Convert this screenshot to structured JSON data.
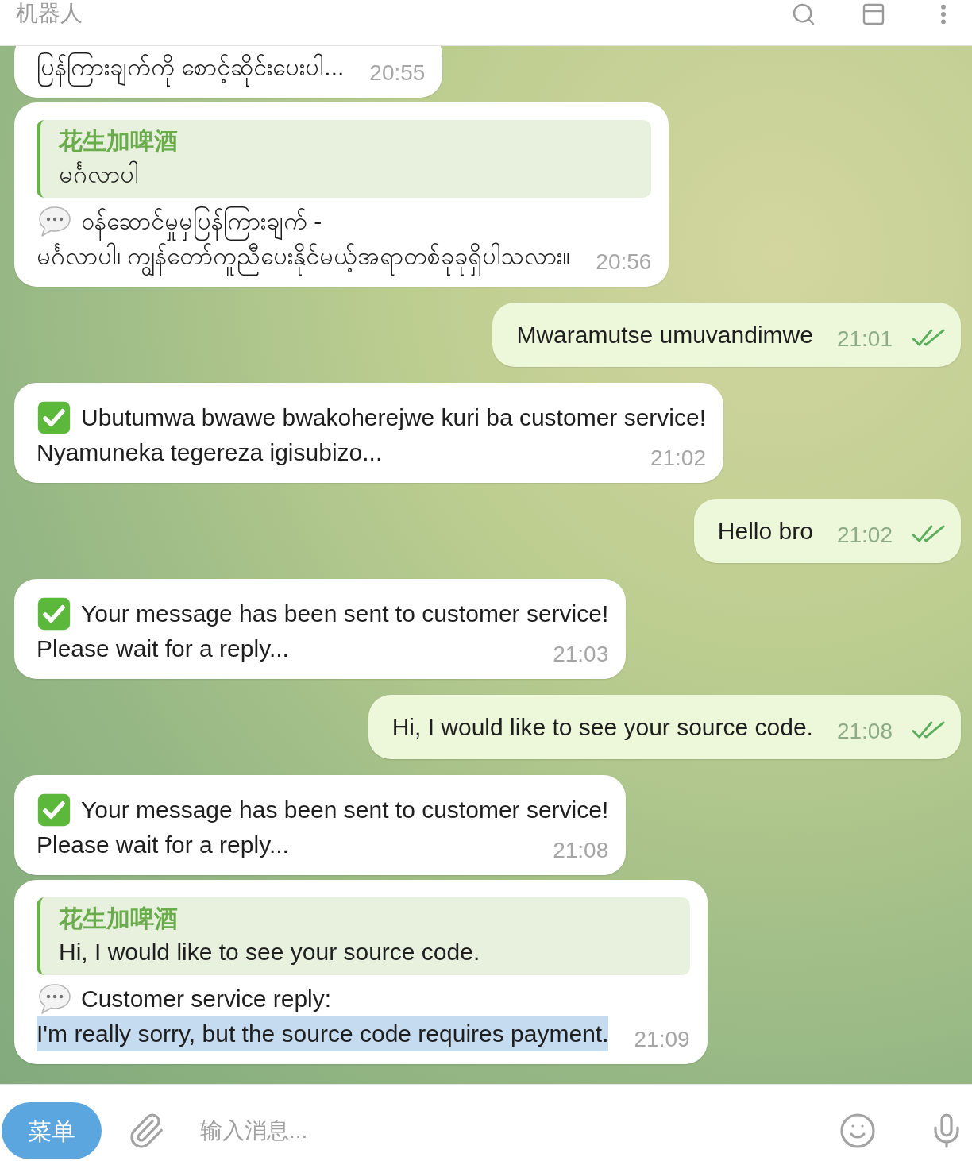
{
  "header": {
    "title": "机器人"
  },
  "messages": [
    {
      "kind": "incoming",
      "lines": [
        {
          "kind": "plain",
          "text": "ပြန်ကြားချက်ကို စောင့်ဆိုင်းပေးပါ...",
          "highlighted": false
        }
      ],
      "time": "20:55"
    },
    {
      "kind": "incoming",
      "quote": {
        "author": "花生加啤酒",
        "text": "မင်္ဂလာပါ"
      },
      "lines": [
        {
          "kind": "reply",
          "text": "ဝန်ဆောင်မှုမှပြန်ကြားချက် -",
          "highlighted": false
        },
        {
          "kind": "plain",
          "text": "မင်္ဂလာပါ၊ ကျွန်တော်ကူညီပေးနိုင်မယ့်အရာတစ်ခုခုရှိပါသလား။",
          "highlighted": false
        }
      ],
      "time": "20:56"
    },
    {
      "kind": "outgoing",
      "lines": [
        {
          "kind": "plain",
          "text": "Mwaramutse umuvandimwe",
          "highlighted": false
        }
      ],
      "time": "21:01",
      "read": true
    },
    {
      "kind": "incoming",
      "lines": [
        {
          "kind": "confirmed",
          "text": "Ubutumwa bwawe bwakoherejwe kuri ba customer service!",
          "highlighted": false
        },
        {
          "kind": "plain",
          "text": "Nyamuneka tegereza igisubizo...",
          "highlighted": false
        }
      ],
      "time": "21:02"
    },
    {
      "kind": "outgoing",
      "lines": [
        {
          "kind": "plain",
          "text": "Hello bro",
          "highlighted": false
        }
      ],
      "time": "21:02",
      "read": true
    },
    {
      "kind": "incoming",
      "lines": [
        {
          "kind": "confirmed",
          "text": "Your message has been sent to customer service!",
          "highlighted": false
        },
        {
          "kind": "plain",
          "text": "Please wait for a reply...",
          "highlighted": false
        }
      ],
      "time": "21:03"
    },
    {
      "kind": "outgoing",
      "lines": [
        {
          "kind": "plain",
          "text": "Hi, I would like to see your source code.",
          "highlighted": false
        }
      ],
      "time": "21:08",
      "read": true
    },
    {
      "kind": "incoming",
      "lines": [
        {
          "kind": "confirmed",
          "text": "Your message has been sent to customer service!",
          "highlighted": false
        },
        {
          "kind": "plain",
          "text": "Please wait for a reply...",
          "highlighted": false
        }
      ],
      "time": "21:08"
    },
    {
      "kind": "incoming",
      "quote": {
        "author": "花生加啤酒",
        "text": "Hi, I would like to see your source code."
      },
      "lines": [
        {
          "kind": "reply",
          "text": "Customer service reply:",
          "highlighted": false
        },
        {
          "kind": "plain",
          "text": "I'm really sorry, but the source code requires payment.",
          "highlighted": true
        }
      ],
      "time": "21:09"
    }
  ],
  "composer": {
    "menu_button": "菜单",
    "placeholder": "输入消息..."
  }
}
